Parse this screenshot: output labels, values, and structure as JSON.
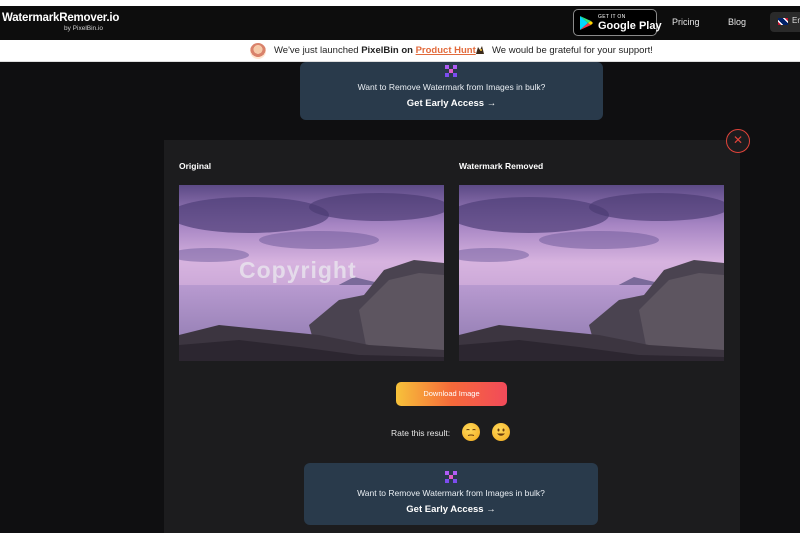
{
  "header": {
    "logo_main": "WatermarkRemover.io",
    "logo_sub": "by PixelBin.io",
    "gplay_small": "GET IT ON",
    "gplay_big": "Google Play",
    "nav_pricing": "Pricing",
    "nav_blog": "Blog",
    "lang_label": "En"
  },
  "announcement": {
    "text_before": "We've just launched ",
    "brand": "PixelBin",
    "on": " on ",
    "link": "Product Hunt",
    "text_after": "We would be grateful for your support!"
  },
  "promo_top": {
    "text": "Want to Remove Watermark from Images in bulk?",
    "cta": "Get Early Access →"
  },
  "result": {
    "label_original": "Original",
    "label_removed": "Watermark Removed",
    "watermark_text": "Copyright",
    "close_glyph": "✕",
    "download_label": "Download Image",
    "rate_label": "Rate this result:"
  },
  "promo_bottom": {
    "text": "Want to Remove Watermark from Images in bulk?",
    "cta": "Get Early Access →"
  },
  "colors": {
    "accent_orange": "#f56a3a",
    "promo_bg": "#293a4b",
    "close_red": "#e0433a"
  }
}
